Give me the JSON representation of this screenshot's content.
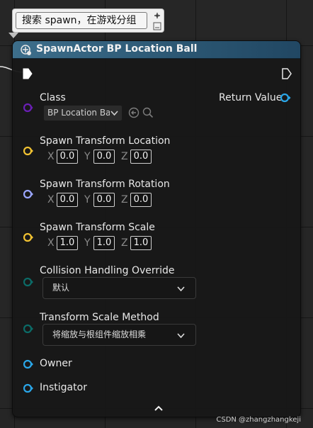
{
  "comment": {
    "text": "搜索 spawn，在游戏分组"
  },
  "node": {
    "title": "SpawnActor BP Location Ball",
    "header_color": "#2c5874"
  },
  "pins": {
    "class": {
      "label": "Class",
      "selected": "BP Location Ball",
      "color": "#6a1fb5"
    },
    "return_value": {
      "label": "Return Value",
      "color": "#2aa6e8"
    },
    "location": {
      "label": "Spawn Transform Location",
      "x": "0.0",
      "y": "0.0",
      "z": "0.0",
      "color": "#f1c232"
    },
    "rotation": {
      "label": "Spawn Transform Rotation",
      "x": "0.0",
      "y": "0.0",
      "z": "0.0",
      "color": "#9aa6ff"
    },
    "scale": {
      "label": "Spawn Transform Scale",
      "x": "1.0",
      "y": "1.0",
      "z": "1.0",
      "color": "#f1c232"
    },
    "collision": {
      "label": "Collision Handling Override",
      "selected": "默认",
      "color": "#0b6b67"
    },
    "scale_method": {
      "label": "Transform Scale Method",
      "selected": "将缩放与根组件缩放相乘",
      "color": "#0b6b67"
    },
    "owner": {
      "label": "Owner",
      "color": "#2aa6e8"
    },
    "instigator": {
      "label": "Instigator",
      "color": "#2aa6e8"
    }
  },
  "axes": {
    "x": "X",
    "y": "Y",
    "z": "Z"
  },
  "watermark": "CSDN @zhangzhangkeji"
}
